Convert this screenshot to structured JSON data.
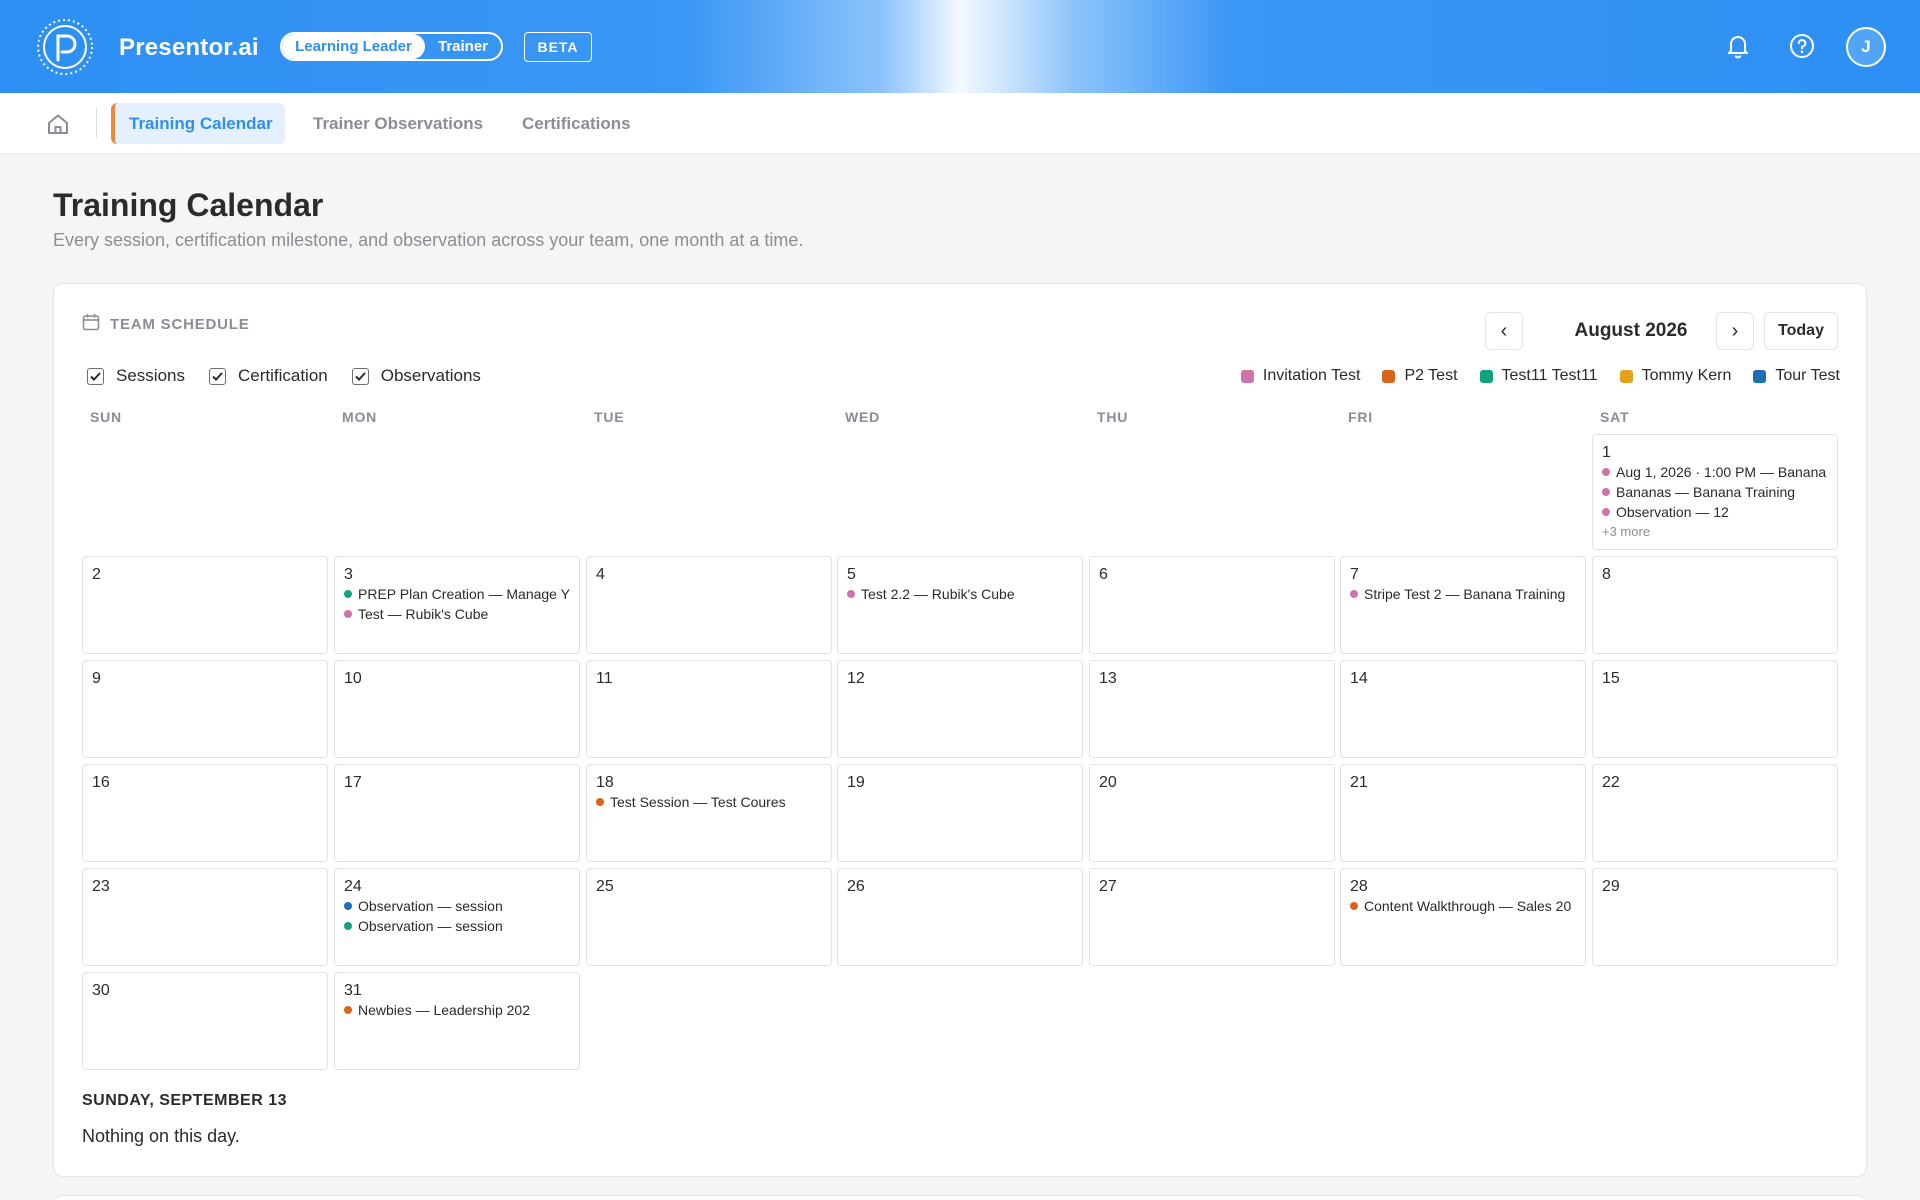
{
  "brand": {
    "name": "Presentor.ai"
  },
  "roles": {
    "active": "Learning Leader",
    "inactive": "Trainer"
  },
  "beta_label": "BETA",
  "user": {
    "initial": "J"
  },
  "nav": {
    "tabs": [
      "Training Calendar",
      "Trainer Observations",
      "Certifications"
    ],
    "active_index": 0
  },
  "page": {
    "title": "Training Calendar",
    "subtitle": "Every session, certification milestone, and observation across your team, one month at a time."
  },
  "schedule": {
    "label": "TEAM SCHEDULE",
    "month": "August 2026",
    "prev_glyph": "‹",
    "next_glyph": "›",
    "today_label": "Today",
    "filters": [
      {
        "label": "Sessions",
        "checked": true
      },
      {
        "label": "Certification",
        "checked": true
      },
      {
        "label": "Observations",
        "checked": true
      }
    ],
    "legend": [
      {
        "label": "Invitation Test",
        "color": "#cf74a8"
      },
      {
        "label": "P2 Test",
        "color": "#d8661a"
      },
      {
        "label": "Test11 Test11",
        "color": "#13a37c"
      },
      {
        "label": "Tommy Kern",
        "color": "#e2a21c"
      },
      {
        "label": "Tour Test",
        "color": "#1b6fb4"
      }
    ],
    "weekdays": [
      "SUN",
      "MON",
      "TUE",
      "WED",
      "THU",
      "FRI",
      "SAT"
    ],
    "days": [
      {
        "day": "1",
        "events": [
          {
            "text": "Aug 1, 2026 · 1:00 PM — Banana",
            "color": "#cf74a8"
          },
          {
            "text": "Bananas — Banana Training",
            "color": "#cf74a8"
          },
          {
            "text": "Observation — 12",
            "color": "#cf74a8"
          }
        ],
        "more": "+3 more"
      },
      {
        "day": "2",
        "events": []
      },
      {
        "day": "3",
        "events": [
          {
            "text": "PREP Plan Creation — Manage Y",
            "color": "#13a37c"
          },
          {
            "text": "Test — Rubik's Cube",
            "color": "#cf74a8"
          }
        ]
      },
      {
        "day": "4",
        "events": []
      },
      {
        "day": "5",
        "events": [
          {
            "text": "Test 2.2 — Rubik's Cube",
            "color": "#cf74a8"
          }
        ]
      },
      {
        "day": "6",
        "events": []
      },
      {
        "day": "7",
        "events": [
          {
            "text": "Stripe Test 2 — Banana Training",
            "color": "#cf74a8"
          }
        ]
      },
      {
        "day": "8",
        "events": []
      },
      {
        "day": "9",
        "events": []
      },
      {
        "day": "10",
        "events": []
      },
      {
        "day": "11",
        "events": []
      },
      {
        "day": "12",
        "events": []
      },
      {
        "day": "13",
        "events": []
      },
      {
        "day": "14",
        "events": []
      },
      {
        "day": "15",
        "events": []
      },
      {
        "day": "16",
        "events": []
      },
      {
        "day": "17",
        "events": []
      },
      {
        "day": "18",
        "events": [
          {
            "text": "Test Session — Test Coures",
            "color": "#d8661a"
          }
        ]
      },
      {
        "day": "19",
        "events": []
      },
      {
        "day": "20",
        "events": []
      },
      {
        "day": "21",
        "events": []
      },
      {
        "day": "22",
        "events": []
      },
      {
        "day": "23",
        "events": []
      },
      {
        "day": "24",
        "events": [
          {
            "text": "Observation — session",
            "color": "#1b6fb4"
          },
          {
            "text": "Observation — session",
            "color": "#13a37c"
          }
        ]
      },
      {
        "day": "25",
        "events": []
      },
      {
        "day": "26",
        "events": []
      },
      {
        "day": "27",
        "events": []
      },
      {
        "day": "28",
        "events": [
          {
            "text": "Content Walkthrough — Sales 20",
            "color": "#d8661a"
          }
        ]
      },
      {
        "day": "29",
        "events": []
      },
      {
        "day": "30",
        "events": []
      },
      {
        "day": "31",
        "events": [
          {
            "text": "Newbies — Leadership 202",
            "color": "#d8661a"
          }
        ]
      }
    ],
    "selected_day": {
      "title": "SUNDAY, SEPTEMBER 13",
      "empty_text": "Nothing on this day."
    }
  }
}
